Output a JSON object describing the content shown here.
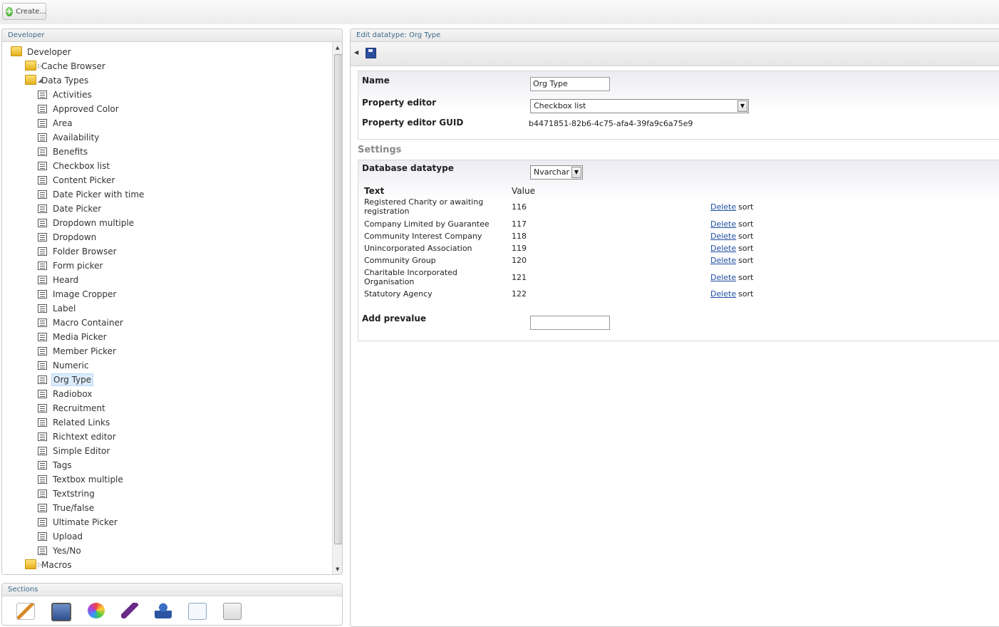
{
  "toolbar": {
    "create_label": "Create..."
  },
  "tree_panel": {
    "title": "Developer",
    "items": [
      {
        "label": "Developer",
        "type": "folder"
      },
      {
        "label": "Cache Browser",
        "type": "folder"
      },
      {
        "label": "Data Types",
        "type": "folder"
      },
      {
        "label": "Activities",
        "type": "datatype"
      },
      {
        "label": "Approved Color",
        "type": "datatype"
      },
      {
        "label": "Area",
        "type": "datatype"
      },
      {
        "label": "Availability",
        "type": "datatype"
      },
      {
        "label": "Benefits",
        "type": "datatype"
      },
      {
        "label": "Checkbox list",
        "type": "datatype"
      },
      {
        "label": "Content Picker",
        "type": "datatype"
      },
      {
        "label": "Date Picker with time",
        "type": "datatype"
      },
      {
        "label": "Date Picker",
        "type": "datatype"
      },
      {
        "label": "Dropdown multiple",
        "type": "datatype"
      },
      {
        "label": "Dropdown",
        "type": "datatype"
      },
      {
        "label": "Folder Browser",
        "type": "datatype"
      },
      {
        "label": "Form picker",
        "type": "datatype"
      },
      {
        "label": "Heard",
        "type": "datatype"
      },
      {
        "label": "Image Cropper",
        "type": "datatype"
      },
      {
        "label": "Label",
        "type": "datatype"
      },
      {
        "label": "Macro Container",
        "type": "datatype"
      },
      {
        "label": "Media Picker",
        "type": "datatype"
      },
      {
        "label": "Member Picker",
        "type": "datatype"
      },
      {
        "label": "Numeric",
        "type": "datatype"
      },
      {
        "label": "Org Type",
        "type": "datatype",
        "selected": true
      },
      {
        "label": "Radiobox",
        "type": "datatype"
      },
      {
        "label": "Recruitment",
        "type": "datatype"
      },
      {
        "label": "Related Links",
        "type": "datatype"
      },
      {
        "label": "Richtext editor",
        "type": "datatype"
      },
      {
        "label": "Simple Editor",
        "type": "datatype"
      },
      {
        "label": "Tags",
        "type": "datatype"
      },
      {
        "label": "Textbox multiple",
        "type": "datatype"
      },
      {
        "label": "Textstring",
        "type": "datatype"
      },
      {
        "label": "True/false",
        "type": "datatype"
      },
      {
        "label": "Ultimate Picker",
        "type": "datatype"
      },
      {
        "label": "Upload",
        "type": "datatype"
      },
      {
        "label": "Yes/No",
        "type": "datatype"
      },
      {
        "label": "Macros",
        "type": "folder"
      }
    ]
  },
  "sections_panel": {
    "title": "Sections",
    "icons": [
      "content-icon",
      "media-icon",
      "settings-icon",
      "developer-icon",
      "users-icon",
      "members-icon",
      "forms-icon"
    ]
  },
  "edit_panel": {
    "title": "Edit datatype: Org Type",
    "name_label": "Name",
    "name_value": "Org Type",
    "property_editor_label": "Property editor",
    "property_editor_value": "Checkbox list",
    "guid_label": "Property editor GUID",
    "guid_value": "b4471851-82b6-4c75-afa4-39fa9c6a75e9",
    "settings_title": "Settings",
    "db_datatype_label": "Database datatype",
    "db_datatype_value": "Nvarchar",
    "col_text": "Text",
    "col_value": "Value",
    "prevalues": [
      {
        "text": "Registered Charity or awaiting registration",
        "value": "116"
      },
      {
        "text": "Company Limited by Guarantee",
        "value": "117"
      },
      {
        "text": "Community Interest Company",
        "value": "118"
      },
      {
        "text": "Unincorporated Association",
        "value": "119"
      },
      {
        "text": "Community Group",
        "value": "120"
      },
      {
        "text": "Charitable Incorporated Organisation",
        "value": "121"
      },
      {
        "text": "Statutory Agency",
        "value": "122"
      }
    ],
    "delete_label": "Delete",
    "sort_label": "sort",
    "add_prevalue_label": "Add prevalue",
    "add_prevalue_value": ""
  },
  "colors": {
    "header_text": "#3e6a8a",
    "link": "#1f4ea3",
    "selected_bg": "#dcecfb"
  }
}
